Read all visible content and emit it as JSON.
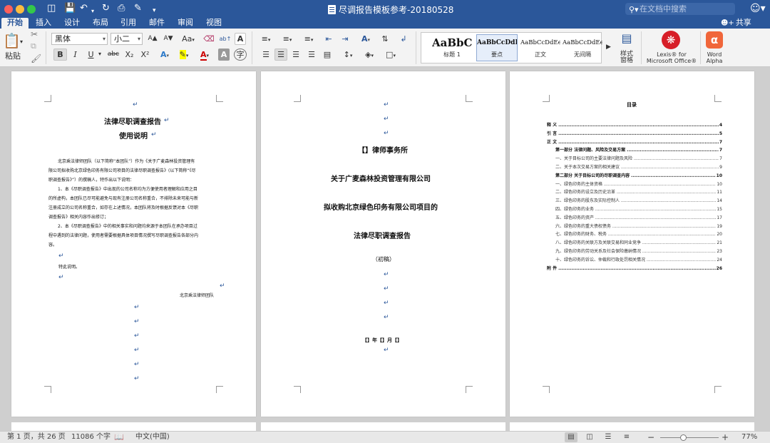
{
  "window": {
    "title": "尽调报告模板参考-20180528",
    "search_placeholder": "在文档中搜索"
  },
  "quick_access": {
    "sidebar_icon": "sidebar-icon",
    "save_icon": "save-icon",
    "undo_icon": "undo-icon",
    "redo_icon": "redo-icon",
    "print_icon": "print-icon",
    "edit_icon": "edit-icon",
    "more_icon": "more-icon"
  },
  "tabs": [
    "开始",
    "插入",
    "设计",
    "布局",
    "引用",
    "邮件",
    "审阅",
    "视图"
  ],
  "share_label": "共享",
  "ribbon": {
    "paste_label": "粘贴",
    "font_name": "黑体",
    "font_size": "小二",
    "grow_font": "A▲",
    "shrink_font": "A▼",
    "aa_button": "Aa",
    "bold": "B",
    "italic": "I",
    "underline": "U",
    "strike": "abc",
    "subscript": "X₂",
    "superscript": "X²",
    "styles": [
      {
        "sample": "AaBbCc",
        "name": "标题 1"
      },
      {
        "sample": "AaBbCcDdE",
        "name": "要点"
      },
      {
        "sample": "AaBbCcDdEe",
        "name": "正文"
      },
      {
        "sample": "AaBbCcDdEe",
        "name": "无间隔"
      }
    ],
    "styles_pane_label": "样式\n窗格",
    "lexis_label": "Lexis® for\nMicrosoft Office®",
    "word_alpha_label": "Word\nAlpha"
  },
  "pages": {
    "page1": {
      "title": "法律尽职调查报告",
      "subtitle": "使用说明",
      "paragraphs": [
        "北京乘法律师团队（以下简称“本团队”）作为《关于广麦森林投资管理有",
        "限公司拟收购北京绿色印务有限公司项目的法律尽职调查报告》(以下简称“《尽",
        "职调查报告》”）的撰稿人，特作出以下说明：",
        "1、本《尽职调查报告》中出现的公司名称均为方便使用者理解和应用之目",
        "的所虚构，本团队已尽可能避免与现有注册公司名称重合，不排除未来可能与新",
        "注册成立的公司名称重合，如存在上述情况，本团队将及时根据反馈对本《尽职",
        "调查报告》相关内容作出修订；",
        "2、本《尽职调查报告》中的相关事实和问题均来源于本团队在承办项目过",
        "程中遇到的法律问题，使用者需要根据具体项目情况撰写尽职调查报告各部分内",
        "容。"
      ],
      "closing": "特此说明。",
      "signature": "北京乘法律师团队"
    },
    "page2": {
      "firm": "【】律师事务所",
      "client": "关于广麦森林投资管理有限公司",
      "project": "拟收购北京绿色印务有限公司项目的",
      "report": "法律尽职调查报告",
      "draft": "（初稿）",
      "date": "【】年【】月【】"
    },
    "page3": {
      "toc_title": "目录",
      "toc": [
        {
          "text": "释  义",
          "page": "4",
          "level": 1
        },
        {
          "text": "引  言",
          "page": "5",
          "level": 1
        },
        {
          "text": "正  文",
          "page": "7",
          "level": 1
        },
        {
          "text": "第一部分  法律问题、风险及交易方案",
          "page": "7",
          "level": 2
        },
        {
          "text": "一、关于目标公司的主要法律问题及风险",
          "page": "7",
          "level": 3
        },
        {
          "text": "二、关于本次交易方案的相关建议",
          "page": "9",
          "level": 3
        },
        {
          "text": "第二部分  关于目标公司的尽职调查内容",
          "page": "10",
          "level": 2
        },
        {
          "text": "一、绿色印务的主体资格",
          "page": "10",
          "level": 3
        },
        {
          "text": "二、绿色印务的设立及历史沿革",
          "page": "11",
          "level": 3
        },
        {
          "text": "三、绿色印务的股东及实际控制人",
          "page": "14",
          "level": 3
        },
        {
          "text": "四、绿色印务的业务",
          "page": "15",
          "level": 3
        },
        {
          "text": "五、绿色印务的资产",
          "page": "17",
          "level": 3
        },
        {
          "text": "六、绿色印务的重大债权债务",
          "page": "19",
          "level": 3
        },
        {
          "text": "七、绿色印务的财务、税务",
          "page": "20",
          "level": 3
        },
        {
          "text": "八、绿色印务的关联方及关联交易和同业竞争",
          "page": "21",
          "level": 3
        },
        {
          "text": "九、绿色印务的劳动关系及社会保险缴纳情况",
          "page": "23",
          "level": 3
        },
        {
          "text": "十、绿色印务的诉讼、仲裁和行政处罚相关情况",
          "page": "24",
          "level": 3
        },
        {
          "text": "附  件",
          "page": "26",
          "level": 1
        }
      ]
    }
  },
  "status": {
    "page_info": "第 1 页，共 26 页",
    "word_count": "11086 个字",
    "language": "中文(中国)",
    "zoom": "77%",
    "zoom_level_percent": 77
  }
}
